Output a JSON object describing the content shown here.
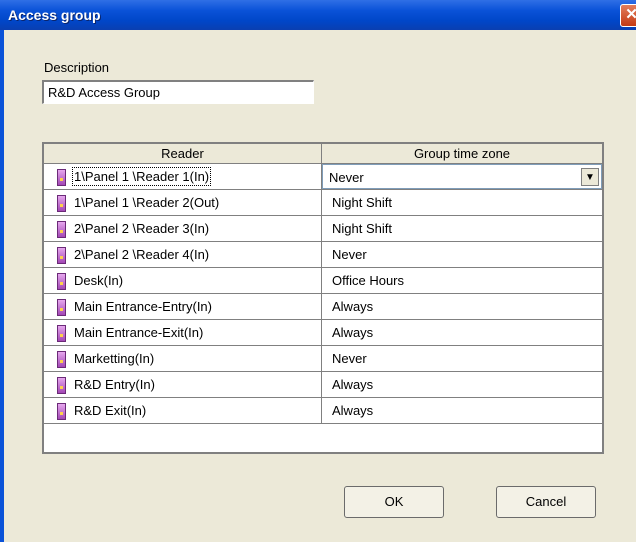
{
  "window": {
    "title": "Access group",
    "close_symbol": "✕"
  },
  "description": {
    "label": "Description",
    "value": "R&D Access Group"
  },
  "grid": {
    "columns": {
      "reader": "Reader",
      "time_zone": "Group time zone"
    },
    "rows": [
      {
        "reader": "1\\Panel 1 \\Reader 1(In)",
        "zone": "Never"
      },
      {
        "reader": "1\\Panel 1 \\Reader 2(Out)",
        "zone": "Night Shift"
      },
      {
        "reader": "2\\Panel 2 \\Reader 3(In)",
        "zone": "Night Shift"
      },
      {
        "reader": "2\\Panel 2 \\Reader 4(In)",
        "zone": "Never"
      },
      {
        "reader": "Desk(In)",
        "zone": "Office Hours"
      },
      {
        "reader": "Main Entrance-Entry(In)",
        "zone": "Always"
      },
      {
        "reader": "Main Entrance-Exit(In)",
        "zone": "Always"
      },
      {
        "reader": "Marketting(In)",
        "zone": "Never"
      },
      {
        "reader": "R&D Entry(In)",
        "zone": "Always"
      },
      {
        "reader": "R&D Exit(In)",
        "zone": "Always"
      }
    ],
    "dropdown_symbol": "▼"
  },
  "buttons": {
    "ok": "OK",
    "cancel": "Cancel"
  },
  "icons": {
    "reader": "reader-icon",
    "close": "close-icon",
    "dropdown": "chevron-down-icon"
  },
  "colors": {
    "titlebar": "#0a52d8",
    "dialog_bg": "#ece9d8"
  }
}
